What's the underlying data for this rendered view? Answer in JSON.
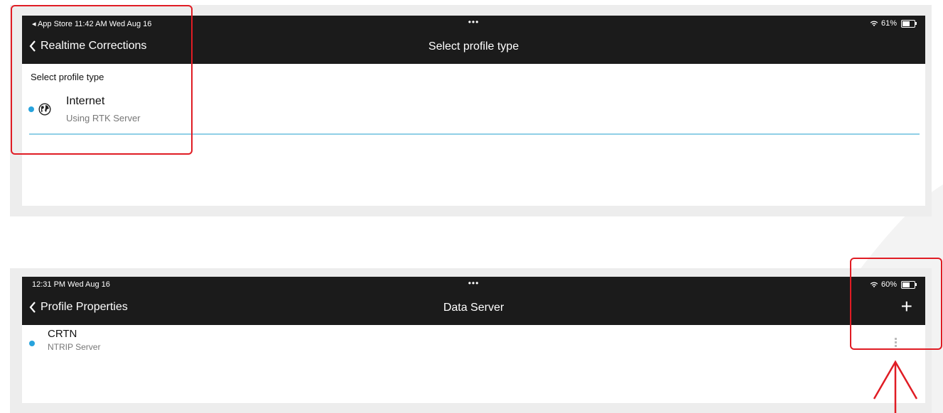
{
  "top_screen": {
    "status_bar": {
      "left_text": "◂ App Store  11:42 AM  Wed Aug 16",
      "center_dots": "•••",
      "right_text": "61%",
      "battery_level": 0.61
    },
    "nav": {
      "back_label": "Realtime Corrections",
      "title": "Select profile type"
    },
    "section_label": "Select profile type",
    "profile_types": [
      {
        "title": "Internet",
        "subtitle": "Using RTK Server",
        "icon": "globe-icon",
        "selected": true
      }
    ]
  },
  "bottom_screen": {
    "status_bar": {
      "left_text": "12:31 PM  Wed Aug 16",
      "center_dots": "•••",
      "right_text": "60%",
      "battery_level": 0.6
    },
    "nav": {
      "back_label": "Profile Properties",
      "title": "Data Server",
      "add_label": "+"
    },
    "servers": [
      {
        "title": "CRTN",
        "subtitle": "NTRIP Server",
        "selected": true
      }
    ]
  },
  "colors": {
    "bar_bg": "#1b1b1b",
    "accent_blue": "#27a3dd",
    "highlight_red": "#e01c24",
    "divider": "#8fcfe6"
  }
}
